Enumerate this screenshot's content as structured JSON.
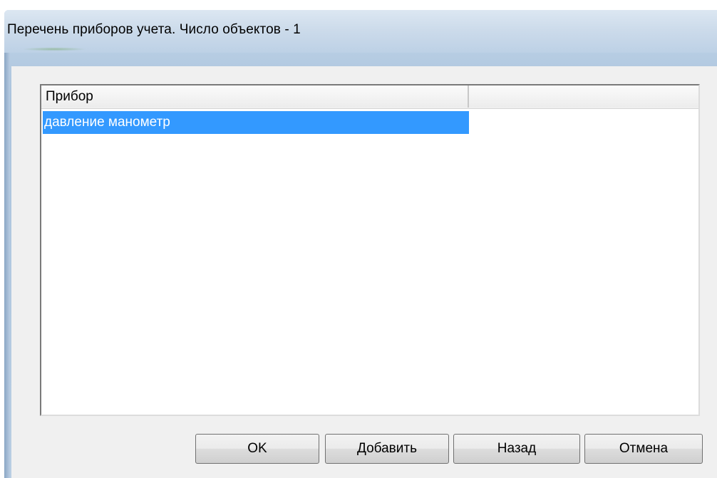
{
  "window": {
    "title": "Перечень приборов учета. Число объектов - 1"
  },
  "list": {
    "columns": [
      "Прибор",
      ""
    ],
    "rows": [
      {
        "label": "давление манометр",
        "selected": true
      }
    ]
  },
  "buttons": {
    "ok": "OK",
    "add": "Добавить",
    "back": "Назад",
    "cancel": "Отмена"
  },
  "colors": {
    "selection": "#3399ff",
    "dialog_face": "#f0f0f0",
    "frame": "#b9cee3"
  }
}
